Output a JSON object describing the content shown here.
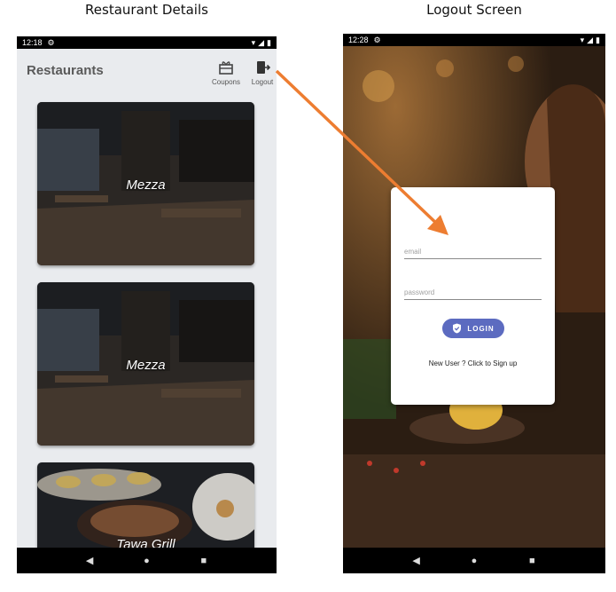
{
  "captions": {
    "left": "Restaurant Details",
    "right": "Logout Screen"
  },
  "left_screen": {
    "status_time": "12:18",
    "title": "Restaurants",
    "actions": [
      {
        "label": "Coupons",
        "icon": "coupon-icon"
      },
      {
        "label": "Logout",
        "icon": "logout-icon"
      }
    ],
    "restaurants": [
      {
        "name": "Mezza"
      },
      {
        "name": "Mezza"
      },
      {
        "name": "Tawa Grill"
      }
    ]
  },
  "right_screen": {
    "status_time": "12:28",
    "email_placeholder": "email",
    "password_placeholder": "password",
    "login_label": "LOGIN",
    "signup_text": "New User ? Click to Sign up"
  },
  "colors": {
    "accent_button": "#5c6bc0",
    "arrow": "#ed7d31"
  }
}
